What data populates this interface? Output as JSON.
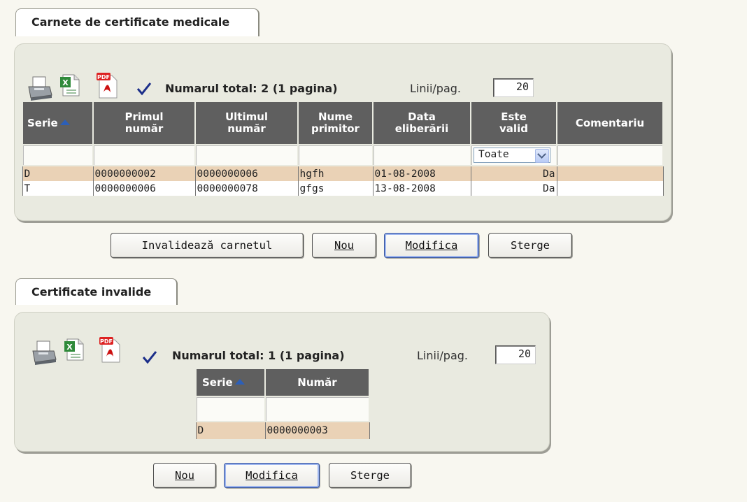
{
  "carnete": {
    "tab_label": "Carnete de certificate medicale",
    "toolbar": {
      "total_label": "Numarul total: 2 (1 pagina)",
      "lines_label": "Linii/pag.",
      "lines_value": "20"
    },
    "columns": [
      "Serie",
      "Primul număr",
      "Ultimul număr",
      "Nume primitor",
      "Data eliberării",
      "Este valid",
      "Comentariu"
    ],
    "column_lines": [
      [
        "Serie"
      ],
      [
        "Primul",
        "număr"
      ],
      [
        "Ultimul",
        "număr"
      ],
      [
        "Nume",
        "primitor"
      ],
      [
        "Data",
        "eliberării"
      ],
      [
        "Este",
        "valid"
      ],
      [
        "Comentariu"
      ]
    ],
    "filter_select": "Toate",
    "rows": [
      [
        "D",
        "0000000002",
        "0000000006",
        "hgfh",
        "01-08-2008",
        "Da",
        ""
      ],
      [
        "T",
        "0000000006",
        "0000000078",
        "gfgs",
        "13-08-2008",
        "Da",
        ""
      ]
    ],
    "buttons": {
      "invalidate": "Invalidează carnetul",
      "new": "Nou",
      "modify": "Modifica",
      "delete": "Sterge"
    }
  },
  "invalide": {
    "tab_label": "Certificate invalide",
    "toolbar": {
      "total_label": "Numarul total: 1 (1 pagina)",
      "lines_label": "Linii/pag.",
      "lines_value": "20"
    },
    "columns": [
      "Serie",
      "Număr"
    ],
    "rows": [
      [
        "D",
        "0000000003"
      ]
    ],
    "buttons": {
      "new": "Nou",
      "modify": "Modifica",
      "delete": "Sterge"
    }
  },
  "icons": [
    "printer-icon",
    "excel-icon",
    "pdf-icon",
    "checkmark-icon",
    "sort-asc-icon",
    "dropdown-arrow-icon"
  ],
  "colors": {
    "header_bg": "#5f5f5f",
    "selected_row": "#ead2b6",
    "panel_bg": "#e9eae0",
    "sort_arrow": "#2c5fb8"
  }
}
